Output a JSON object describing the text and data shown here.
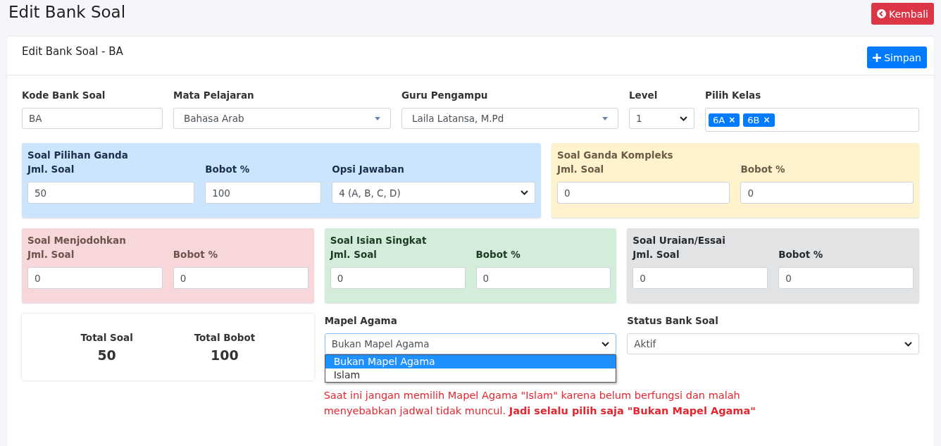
{
  "page": {
    "title": "Edit Bank Soal",
    "back_button": "Kembali"
  },
  "card": {
    "title": "Edit Bank Soal - BA",
    "save_button": "Simpan"
  },
  "top_fields": [
    {
      "kind": "text",
      "label": "Kode Bank Soal",
      "value": "BA"
    },
    {
      "kind": "select2",
      "label": "Mata Pelajaran",
      "value": "Bahasa Arab"
    },
    {
      "kind": "select2",
      "label": "Guru Pengampu",
      "value": "Laila Latansa, M.Pd"
    },
    {
      "kind": "select",
      "label": "Level",
      "value": "1"
    },
    {
      "kind": "tags",
      "label": "Pilih Kelas",
      "tags": [
        "6A",
        "6B"
      ],
      "remove": "×"
    }
  ],
  "sections": [
    {
      "title": "Soal Pilihan Ganda",
      "color": "#cce5ff",
      "fields": [
        {
          "kind": "text",
          "label": "Jml. Soal",
          "value": "50"
        },
        {
          "kind": "text",
          "label": "Bobot %",
          "value": "100"
        },
        {
          "kind": "select",
          "label": "Opsi Jawaban",
          "value": "4 (A, B, C, D)"
        }
      ]
    },
    {
      "title": "Soal Ganda Kompleks",
      "color": "#fff3cd",
      "fields": [
        {
          "kind": "text",
          "label": "Jml. Soal",
          "value": "0"
        },
        {
          "kind": "text",
          "label": "Bobot %",
          "value": "0"
        }
      ]
    },
    {
      "title": "Soal Menjodohkan",
      "color": "#f8d7da",
      "fields": [
        {
          "kind": "text",
          "label": "Jml. Soal",
          "value": "0"
        },
        {
          "kind": "text",
          "label": "Bobot %",
          "value": "0"
        }
      ]
    },
    {
      "title": "Soal Isian Singkat",
      "color": "#d4edda",
      "fields": [
        {
          "kind": "text",
          "label": "Jml. Soal",
          "value": "0"
        },
        {
          "kind": "text",
          "label": "Bobot %",
          "value": "0"
        }
      ]
    },
    {
      "title": "Soal Uraian/Essai",
      "color": "#e2e3e5",
      "fields": [
        {
          "kind": "text",
          "label": "Jml. Soal",
          "value": "0"
        },
        {
          "kind": "text",
          "label": "Bobot %",
          "value": "0"
        }
      ]
    }
  ],
  "totals": [
    {
      "label": "Total Soal",
      "value": "50"
    },
    {
      "label": "Total Bobot",
      "value": "100"
    }
  ],
  "mapel_agama": {
    "label": "Mapel Agama",
    "value": "Bukan Mapel Agama",
    "expanded": true,
    "options": [
      {
        "label": "Bukan Mapel Agama",
        "selected": true
      },
      {
        "label": "Islam",
        "selected": false
      }
    ]
  },
  "status": {
    "label": "Status Bank Soal",
    "value": "Aktif"
  },
  "note": "Saat ini jangan memilih Mapel Agama \"Islam\" karena belum berfungsi dan malah menyebabkan jadwal tidak muncul. **Jadi selalu pilih saja \"Bukan Mapel Agama\"**"
}
